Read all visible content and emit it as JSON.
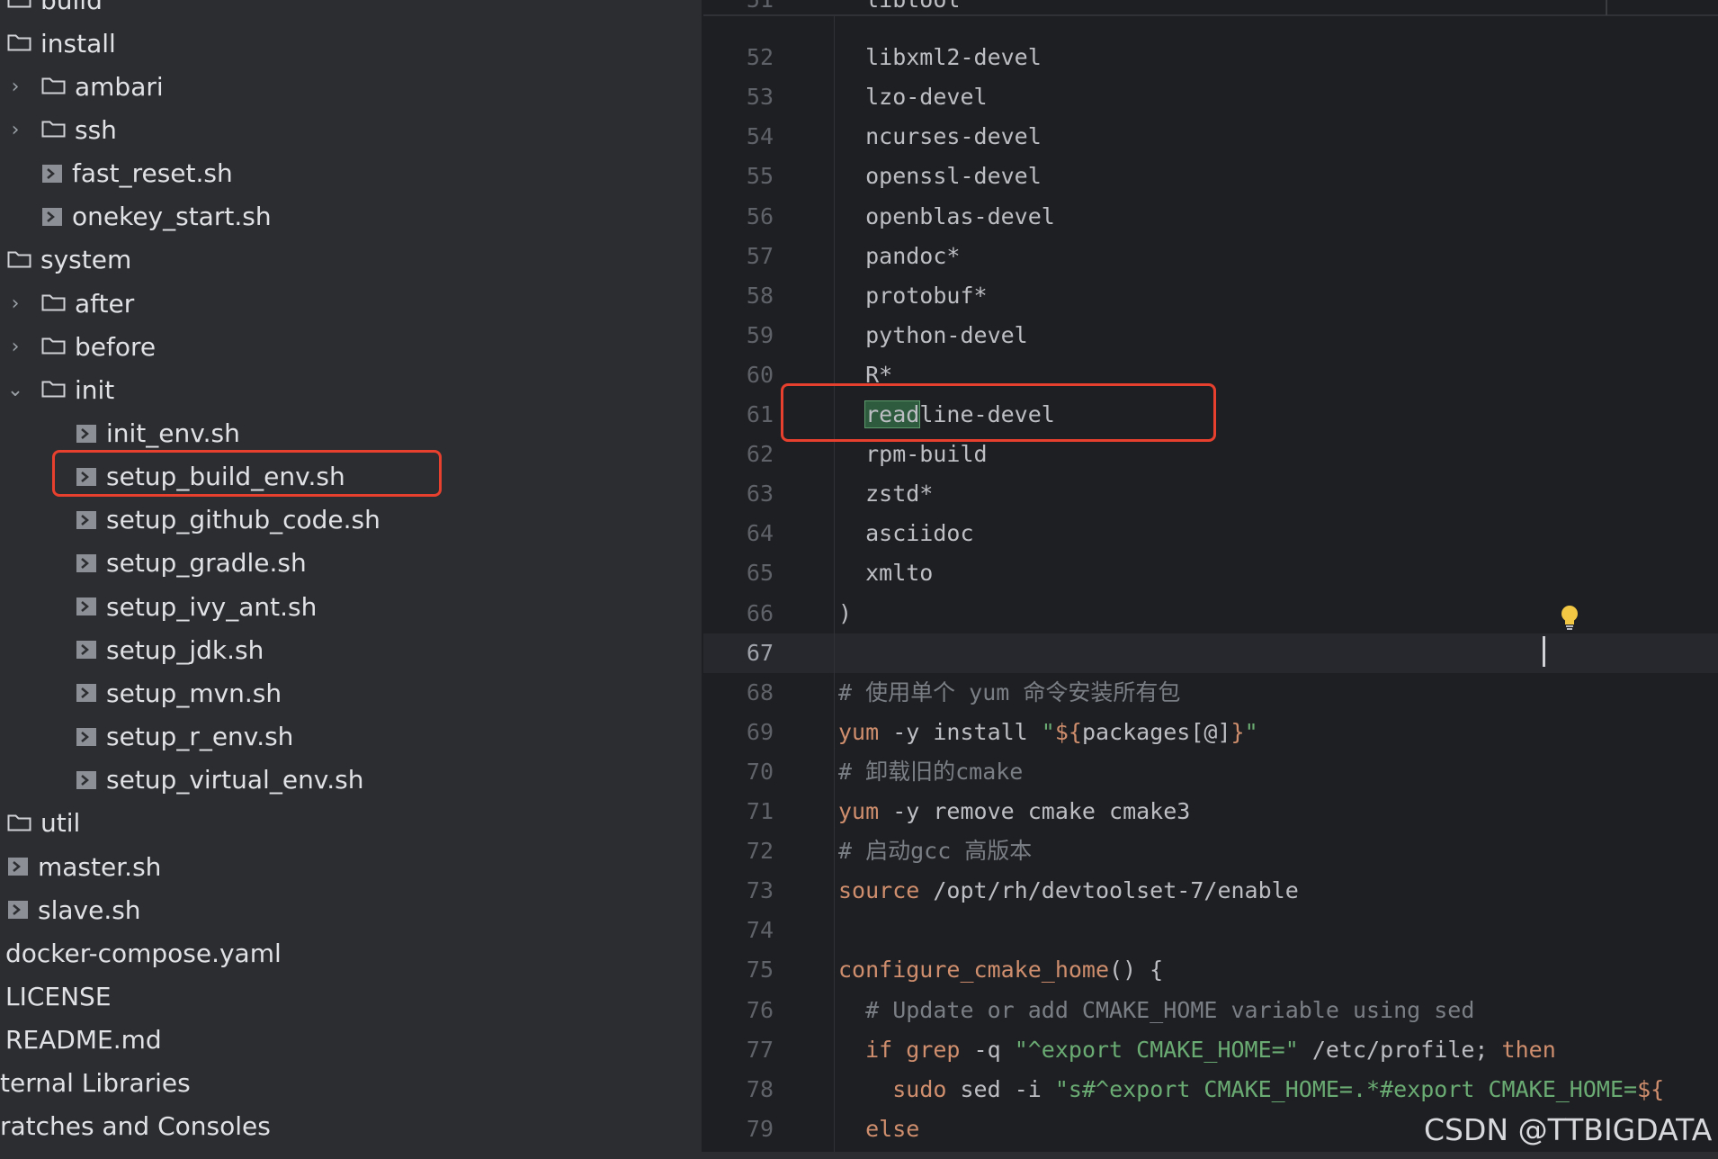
{
  "tree": [
    {
      "label": "build",
      "kind": "folder",
      "depth": 0,
      "chevron": ""
    },
    {
      "label": "install",
      "kind": "folder",
      "depth": 0,
      "chevron": ""
    },
    {
      "label": "ambari",
      "kind": "folder",
      "depth": 1,
      "chevron": "›"
    },
    {
      "label": "ssh",
      "kind": "folder",
      "depth": 1,
      "chevron": "›"
    },
    {
      "label": "fast_reset.sh",
      "kind": "file",
      "depth": 1,
      "chevron": ""
    },
    {
      "label": "onekey_start.sh",
      "kind": "file",
      "depth": 1,
      "chevron": ""
    },
    {
      "label": "system",
      "kind": "folder",
      "depth": 0,
      "chevron": ""
    },
    {
      "label": "after",
      "kind": "folder",
      "depth": 1,
      "chevron": "›"
    },
    {
      "label": "before",
      "kind": "folder",
      "depth": 1,
      "chevron": "›"
    },
    {
      "label": "init",
      "kind": "folder",
      "depth": 1,
      "chevron": "⌄"
    },
    {
      "label": "init_env.sh",
      "kind": "file",
      "depth": 2,
      "chevron": ""
    },
    {
      "label": "setup_build_env.sh",
      "kind": "file",
      "depth": 2,
      "chevron": "",
      "highlighted": true
    },
    {
      "label": "setup_github_code.sh",
      "kind": "file",
      "depth": 2,
      "chevron": ""
    },
    {
      "label": "setup_gradle.sh",
      "kind": "file",
      "depth": 2,
      "chevron": ""
    },
    {
      "label": "setup_ivy_ant.sh",
      "kind": "file",
      "depth": 2,
      "chevron": ""
    },
    {
      "label": "setup_jdk.sh",
      "kind": "file",
      "depth": 2,
      "chevron": ""
    },
    {
      "label": "setup_mvn.sh",
      "kind": "file",
      "depth": 2,
      "chevron": ""
    },
    {
      "label": "setup_r_env.sh",
      "kind": "file",
      "depth": 2,
      "chevron": ""
    },
    {
      "label": "setup_virtual_env.sh",
      "kind": "file",
      "depth": 2,
      "chevron": ""
    },
    {
      "label": "util",
      "kind": "folder",
      "depth": 0,
      "chevron": ""
    },
    {
      "label": "master.sh",
      "kind": "file",
      "depth": 0,
      "chevron": ""
    },
    {
      "label": "slave.sh",
      "kind": "file",
      "depth": 0,
      "chevron": ""
    },
    {
      "label": "docker-compose.yaml",
      "kind": "plain",
      "depth": 0,
      "chevron": ""
    },
    {
      "label": "LICENSE",
      "kind": "plain",
      "depth": 0,
      "chevron": ""
    },
    {
      "label": "README.md",
      "kind": "plain",
      "depth": 0,
      "chevron": ""
    },
    {
      "label": "ternal Libraries",
      "kind": "cut",
      "depth": 0,
      "chevron": ""
    },
    {
      "label": "ratches and Consoles",
      "kind": "cut",
      "depth": 0,
      "chevron": ""
    }
  ],
  "editor": {
    "current_line": "67",
    "highlighted_line": "61",
    "lines": [
      {
        "num": "51",
        "tokens": [
          {
            "t": "  libtool",
            "c": ""
          }
        ]
      },
      {
        "num": "52",
        "tokens": [
          {
            "t": "  libxml2-devel",
            "c": ""
          }
        ]
      },
      {
        "num": "53",
        "tokens": [
          {
            "t": "  lzo-devel",
            "c": ""
          }
        ]
      },
      {
        "num": "54",
        "tokens": [
          {
            "t": "  ncurses-devel",
            "c": ""
          }
        ]
      },
      {
        "num": "55",
        "tokens": [
          {
            "t": "  openssl-devel",
            "c": ""
          }
        ]
      },
      {
        "num": "56",
        "tokens": [
          {
            "t": "  openblas-devel",
            "c": ""
          }
        ]
      },
      {
        "num": "57",
        "tokens": [
          {
            "t": "  pandoc*",
            "c": ""
          }
        ]
      },
      {
        "num": "58",
        "tokens": [
          {
            "t": "  protobuf*",
            "c": ""
          }
        ]
      },
      {
        "num": "59",
        "tokens": [
          {
            "t": "  python-devel",
            "c": ""
          }
        ]
      },
      {
        "num": "60",
        "tokens": [
          {
            "t": "  R*",
            "c": ""
          }
        ]
      },
      {
        "num": "61",
        "tokens": [
          {
            "t": "  ",
            "c": ""
          },
          {
            "t": "read",
            "c": "hl-sel"
          },
          {
            "t": "line-devel",
            "c": ""
          }
        ]
      },
      {
        "num": "62",
        "tokens": [
          {
            "t": "  rpm-build",
            "c": ""
          }
        ]
      },
      {
        "num": "63",
        "tokens": [
          {
            "t": "  zstd*",
            "c": ""
          }
        ]
      },
      {
        "num": "64",
        "tokens": [
          {
            "t": "  asciidoc",
            "c": ""
          }
        ]
      },
      {
        "num": "65",
        "tokens": [
          {
            "t": "  xmlto",
            "c": ""
          }
        ]
      },
      {
        "num": "66",
        "tokens": [
          {
            "t": ")",
            "c": ""
          }
        ]
      },
      {
        "num": "67",
        "tokens": []
      },
      {
        "num": "68",
        "tokens": [
          {
            "t": "# 使用单个 yum 命令安装所有包",
            "c": "cm"
          }
        ]
      },
      {
        "num": "69",
        "tokens": [
          {
            "t": "yum",
            "c": "kw"
          },
          {
            "t": " -y install ",
            "c": ""
          },
          {
            "t": "\"",
            "c": "str"
          },
          {
            "t": "${",
            "c": "dl"
          },
          {
            "t": "packages[@]",
            "c": ""
          },
          {
            "t": "}",
            "c": "dl"
          },
          {
            "t": "\"",
            "c": "str"
          }
        ]
      },
      {
        "num": "70",
        "tokens": [
          {
            "t": "# 卸载旧的cmake",
            "c": "cm"
          }
        ]
      },
      {
        "num": "71",
        "tokens": [
          {
            "t": "yum",
            "c": "kw"
          },
          {
            "t": " -y remove cmake cmake3",
            "c": ""
          }
        ]
      },
      {
        "num": "72",
        "tokens": [
          {
            "t": "# 启动gcc 高版本",
            "c": "cm"
          }
        ]
      },
      {
        "num": "73",
        "tokens": [
          {
            "t": "source",
            "c": "kw"
          },
          {
            "t": " /opt/rh/devtoolset-7/enable",
            "c": ""
          }
        ]
      },
      {
        "num": "74",
        "tokens": []
      },
      {
        "num": "75",
        "tokens": [
          {
            "t": "configure_cmake_home",
            "c": "kw"
          },
          {
            "t": "() {",
            "c": ""
          }
        ]
      },
      {
        "num": "76",
        "tokens": [
          {
            "t": "  # Update or add CMAKE_HOME variable using sed",
            "c": "cm"
          }
        ]
      },
      {
        "num": "77",
        "tokens": [
          {
            "t": "  ",
            "c": ""
          },
          {
            "t": "if grep",
            "c": "kw"
          },
          {
            "t": " -q ",
            "c": ""
          },
          {
            "t": "\"^export CMAKE_HOME=\"",
            "c": "str"
          },
          {
            "t": " /etc/profile; ",
            "c": ""
          },
          {
            "t": "then",
            "c": "kw"
          }
        ]
      },
      {
        "num": "78",
        "tokens": [
          {
            "t": "    ",
            "c": ""
          },
          {
            "t": "sudo",
            "c": "kw"
          },
          {
            "t": " sed -i ",
            "c": ""
          },
          {
            "t": "\"s#^export CMAKE_HOME=.*#export CMAKE_HOME=",
            "c": "str"
          },
          {
            "t": "${",
            "c": "dl"
          }
        ]
      },
      {
        "num": "79",
        "tokens": [
          {
            "t": "  ",
            "c": ""
          },
          {
            "t": "else",
            "c": "kw"
          }
        ]
      }
    ]
  },
  "watermark": "CSDN @TTBIGDATA",
  "icons": {
    "folder": "folder-icon",
    "file": "shell-file-icon",
    "chevron": "chevron-icon",
    "bulb": "lightbulb-icon"
  }
}
